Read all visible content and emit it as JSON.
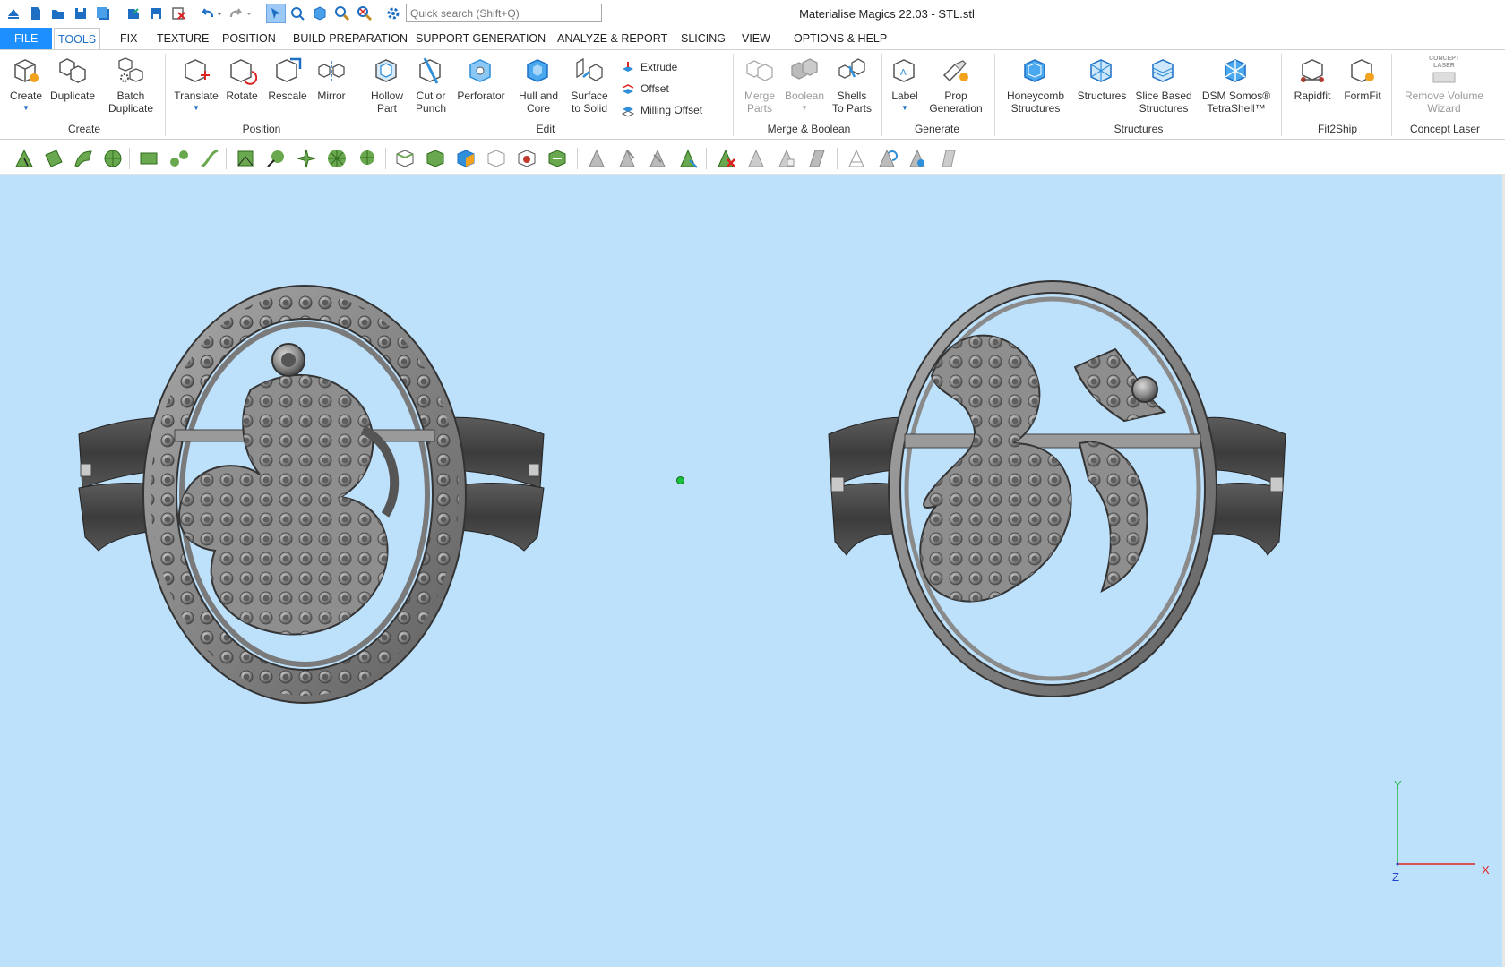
{
  "window": {
    "title": "Materialise Magics 22.03 - STL.stl"
  },
  "quick_access": {
    "search_placeholder": "Quick search (Shift+Q)"
  },
  "tabs": [
    {
      "label": "FILE"
    },
    {
      "label": "TOOLS"
    },
    {
      "label": "FIX"
    },
    {
      "label": "TEXTURE"
    },
    {
      "label": "POSITION"
    },
    {
      "label": "BUILD PREPARATION"
    },
    {
      "label": "SUPPORT GENERATION"
    },
    {
      "label": "ANALYZE & REPORT"
    },
    {
      "label": "SLICING"
    },
    {
      "label": "VIEW"
    },
    {
      "label": "OPTIONS & HELP"
    }
  ],
  "ribbon": {
    "groups": {
      "create": "Create",
      "position": "Position",
      "edit": "Edit",
      "merge_boolean": "Merge & Boolean",
      "generate": "Generate",
      "structures": "Structures",
      "fit2ship": "Fit2Ship",
      "concept_laser": "Concept Laser"
    },
    "buttons": {
      "create": "Create",
      "duplicate": "Duplicate",
      "batch_duplicate_1": "Batch",
      "batch_duplicate_2": "Duplicate",
      "translate": "Translate",
      "rotate": "Rotate",
      "rescale": "Rescale",
      "mirror": "Mirror",
      "hollow_1": "Hollow",
      "hollow_2": "Part",
      "cut_1": "Cut or",
      "cut_2": "Punch",
      "perforator": "Perforator",
      "hull_1": "Hull and",
      "hull_2": "Core",
      "surface_1": "Surface",
      "surface_2": "to Solid",
      "extrude": "Extrude",
      "offset": "Offset",
      "milling_offset": "Milling Offset",
      "merge_1": "Merge",
      "merge_2": "Parts",
      "boolean": "Boolean",
      "shells_1": "Shells",
      "shells_2": "To Parts",
      "label": "Label",
      "prop_1": "Prop",
      "prop_2": "Generation",
      "honeycomb_1": "Honeycomb",
      "honeycomb_2": "Structures",
      "structures": "Structures",
      "slice_1": "Slice Based",
      "slice_2": "Structures",
      "dsm_1": "DSM Somos®",
      "dsm_2": "TetraShell™",
      "rapidfit": "Rapidfit",
      "formfit": "FormFit",
      "remove_1": "Remove Volume",
      "remove_2": "Wizard",
      "concept_logo_1": "CONCEPT",
      "concept_logo_2": "LASER"
    }
  },
  "viewport": {
    "background": "#bde0fb",
    "axes": {
      "x": "X",
      "y": "Y",
      "z": "Z"
    }
  },
  "colors": {
    "accent": "#1e8fff",
    "icon_blue": "#2f8fd8",
    "icon_green": "#6aa84f",
    "model_gray": "#8a8a8a"
  }
}
